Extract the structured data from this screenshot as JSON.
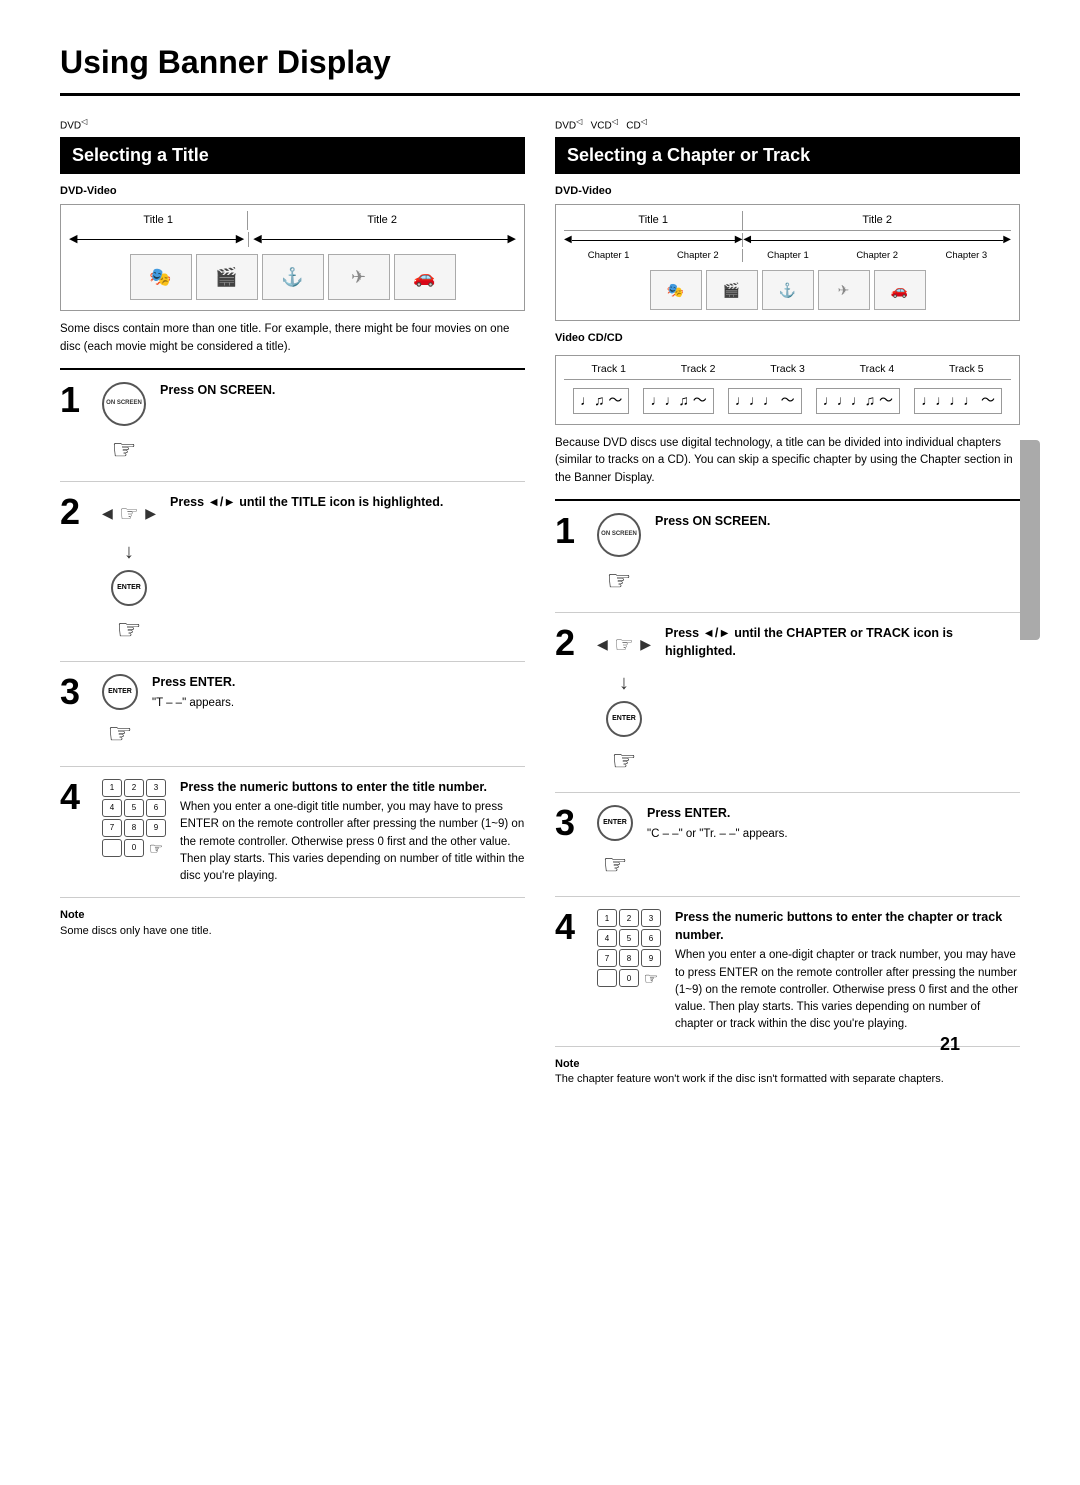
{
  "page": {
    "title": "Using Banner Display",
    "number": "21"
  },
  "left_section": {
    "tag": "DVD",
    "header": "Selecting a Title",
    "subsection_label": "DVD-Video",
    "diagram": {
      "title1": "Title 1",
      "title2": "Title 2",
      "images": [
        "🎭",
        "🎬",
        "⚓",
        "✈",
        "🚗"
      ]
    },
    "description": "Some discs contain more than one title. For example, there might be four movies on one disc (each movie might be considered a title).",
    "steps": [
      {
        "number": "1",
        "bold_text": "Press ON SCREEN.",
        "sub_text": ""
      },
      {
        "number": "2",
        "bold_text": "Press ◄/► until the TITLE icon is highlighted.",
        "sub_text": ""
      },
      {
        "number": "3",
        "bold_text": "Press ENTER.",
        "sub_text": "\"T – –\" appears."
      },
      {
        "number": "4",
        "bold_text": "Press the numeric buttons to enter the title number.",
        "sub_text": "When you enter a one-digit title number, you may have to press ENTER on the remote controller after pressing the number (1~9) on the remote controller. Otherwise press 0 first and the other value. Then play starts. This varies depending on number of title within the disc you're playing."
      }
    ],
    "note": {
      "title": "Note",
      "text": "Some discs only have one title."
    }
  },
  "right_section": {
    "tag1": "DVD",
    "tag2": "VCD",
    "tag3": "CD",
    "header": "Selecting a Chapter or Track",
    "subsection_dvd": "DVD-Video",
    "diagram_dvd": {
      "title1": "Title 1",
      "title2": "Title 2",
      "ch1": "Chapter 1",
      "ch2": "Chapter 2",
      "ch3": "Chapter 1",
      "ch4": "Chapter 2",
      "ch5": "Chapter 3",
      "images": [
        "🎭",
        "🎬",
        "⚓",
        "✈",
        "🚗"
      ]
    },
    "subsection_vcd": "Video CD/CD",
    "diagram_vcd": {
      "track1": "Track 1",
      "track2": "Track 2",
      "track3": "Track 3",
      "track4": "Track 4",
      "track5": "Track 5",
      "notes": [
        "♩♫ ～",
        "♩♩♫ ～",
        "♩♩♩ ～",
        "♩♩♩♫ ～",
        "♩♩♩♩ ～"
      ]
    },
    "description": "Because DVD discs use digital technology, a title can be divided into individual chapters (similar to tracks on a CD). You can skip a specific chapter by using the Chapter section in the Banner Display.",
    "steps": [
      {
        "number": "1",
        "bold_text": "Press ON SCREEN.",
        "sub_text": ""
      },
      {
        "number": "2",
        "bold_text": "Press ◄/► until the CHAPTER or TRACK icon is highlighted.",
        "sub_text": ""
      },
      {
        "number": "3",
        "bold_text": "Press ENTER.",
        "sub_text": "\"C – –\" or \"Tr. – –\" appears."
      },
      {
        "number": "4",
        "bold_text": "Press the numeric buttons to enter the chapter or track number.",
        "sub_text": "When you enter a one-digit chapter or track number, you may have to press ENTER on the remote controller after pressing the number (1~9) on the remote controller. Otherwise press 0 first and the other value. Then play starts. This varies depending on number of chapter or track within the disc you're playing."
      }
    ],
    "note": {
      "title": "Note",
      "text": "The chapter feature won't work if the disc isn't formatted with separate chapters."
    }
  }
}
